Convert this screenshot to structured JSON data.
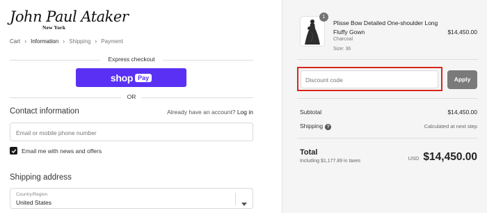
{
  "brand": {
    "name": "John Paul Ataker",
    "location": "New York"
  },
  "breadcrumb": [
    {
      "label": "Cart",
      "state": "link"
    },
    {
      "label": "Information",
      "state": "active"
    },
    {
      "label": "Shipping",
      "state": "disabled"
    },
    {
      "label": "Payment",
      "state": "disabled"
    }
  ],
  "express_checkout": {
    "title": "Express checkout",
    "shop_label": "shop",
    "pay_label": "Pay",
    "or_label": "OR"
  },
  "contact": {
    "title": "Contact information",
    "account_prompt": "Already have an account?",
    "login_label": "Log in",
    "email_placeholder": "Email or mobile phone number",
    "newsletter_label": "Email me with news and offers",
    "newsletter_checked": true
  },
  "shipping": {
    "title": "Shipping address",
    "country_label": "Country/Region",
    "country_value": "United States"
  },
  "order": {
    "item": {
      "quantity": "1",
      "name": "Plisse Bow Detailed One-shoulder Long Fluffy Gown",
      "color": "Charcoal",
      "size": "Size: 36",
      "price": "$14,450.00"
    },
    "discount_placeholder": "Discount code",
    "apply_label": "Apply",
    "subtotal_label": "Subtotal",
    "subtotal_value": "$14,450.00",
    "shipping_label": "Shipping",
    "shipping_value": "Calculated at next step",
    "total_label": "Total",
    "taxes_note": "Including $1,177.89 in taxes",
    "currency": "USD",
    "total_value": "$14,450.00"
  },
  "colors": {
    "shop_pay": "#5a31f4",
    "highlight": "#d9251d",
    "apply_button": "#7a7a7a",
    "summary_bg": "#f5f5f5"
  }
}
